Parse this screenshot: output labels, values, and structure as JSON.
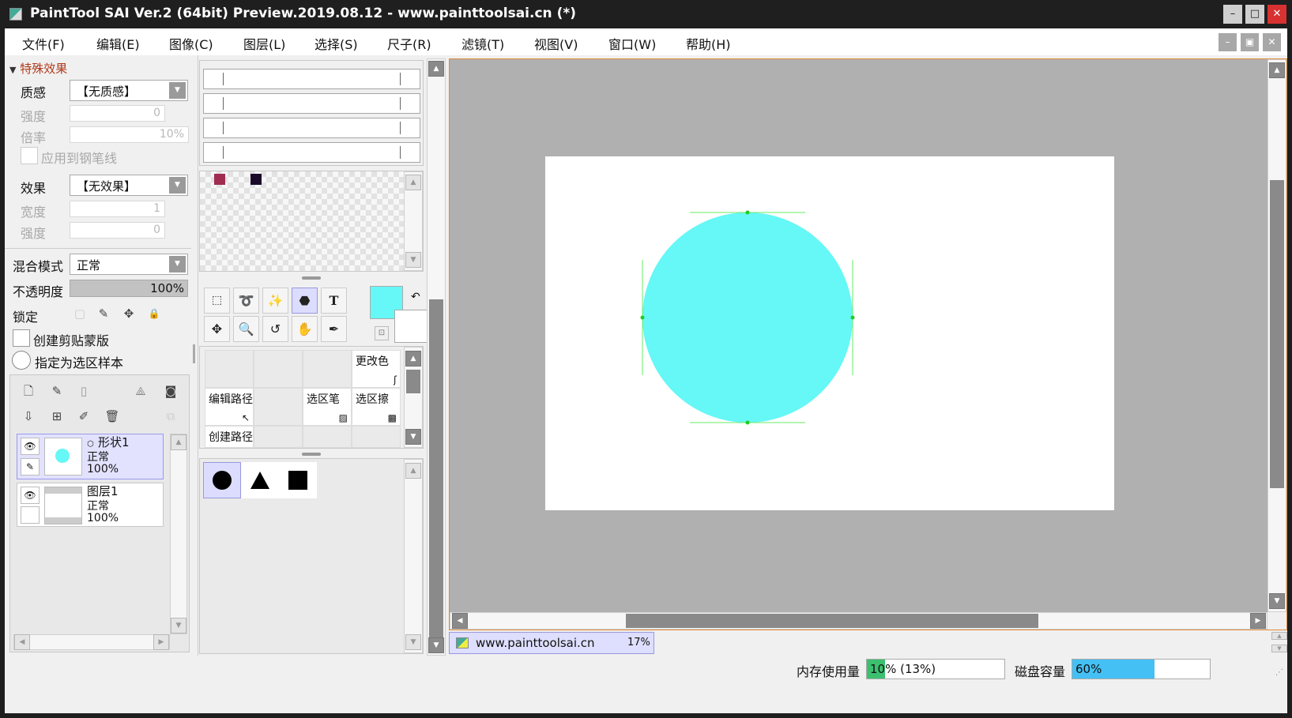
{
  "window": {
    "title": "PaintTool SAI Ver.2 (64bit) Preview.2019.08.12 - www.painttoolsai.cn (*)",
    "minimize": "–",
    "maximize": "□",
    "close": "✕"
  },
  "menu": {
    "file": "文件(F)",
    "edit": "编辑(E)",
    "image": "图像(C)",
    "layer": "图层(L)",
    "select": "选择(S)",
    "ruler": "尺子(R)",
    "filter": "滤镜(T)",
    "view": "视图(V)",
    "window": "窗口(W)",
    "help": "帮助(H)"
  },
  "mdi": {
    "minimize": "–",
    "restore": "▣",
    "close": "✕"
  },
  "effects": {
    "section": "特殊效果",
    "texture_label": "质感",
    "texture_value": "【无质感】",
    "strength_label": "强度",
    "strength_value": "0",
    "rate_label": "倍率",
    "rate_value": "10%",
    "apply_pen": "应用到钢笔线",
    "effect_label": "效果",
    "effect_value": "【无效果】",
    "width_label": "宽度",
    "width_value": "1",
    "strength2_label": "强度",
    "strength2_value": "0"
  },
  "layer_props": {
    "blend_label": "混合模式",
    "blend_value": "正常",
    "opacity_label": "不透明度",
    "opacity_value": "100%",
    "opacity_fraction": 1.0,
    "lock_label": "锁定",
    "clip_label": "创建剪贴蒙版",
    "sample_label": "指定为选区样本"
  },
  "layers": [
    {
      "name": "形状1",
      "mode": "正常",
      "opacity": "100%"
    },
    {
      "name": "图层1",
      "mode": "正常",
      "opacity": "100%"
    }
  ],
  "tools": {
    "change_color": "更改色",
    "edit_path": "编辑路径",
    "sel_pen": "选区笔",
    "sel_eraser": "选区擦",
    "create_path": "创建路径",
    "text_tool": "T"
  },
  "colors": {
    "primary": "#66f7f7",
    "swatch1": "#a02c52",
    "swatch2": "#1c0a2a",
    "canvas_bg": "#ffffff",
    "workspace_bg": "#b0b0b0",
    "circle": "#66f7f7",
    "guide": "#66ee66"
  },
  "doc_tab": {
    "name": "www.painttoolsai.cn",
    "zoom": "17%"
  },
  "status": {
    "mem_label": "内存使用量",
    "mem_value": "10% (13%)",
    "mem_fraction": 0.1,
    "disk_label": "磁盘容量",
    "disk_value": "60%",
    "disk_fraction": 0.6
  }
}
